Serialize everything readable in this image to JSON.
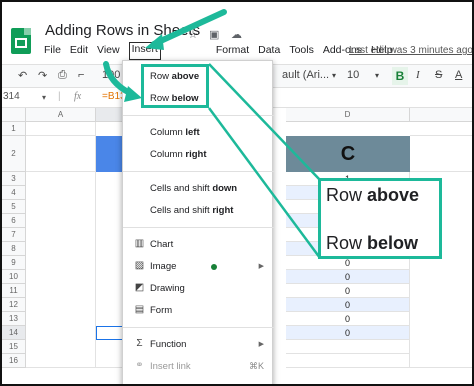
{
  "app": {
    "doc_title": "Adding Rows in Sheets",
    "title_icons": [
      "star-icon",
      "move-to-folder-icon",
      "cloud-saved-icon"
    ],
    "last_edit": "Last edit was 3 minutes ago"
  },
  "menubar": {
    "items": [
      "File",
      "Edit",
      "View",
      "Insert",
      "Format",
      "Data",
      "Tools",
      "Add-ons",
      "Help"
    ],
    "active": "Insert"
  },
  "toolbar": {
    "zoom": "100",
    "font": "ault (Ari...",
    "font_size": "10",
    "bold": "B",
    "italic": "I",
    "strike": "S",
    "text_color": "A"
  },
  "formula_bar": {
    "cell_ref": "314",
    "fx": "fx",
    "formula": "=B13"
  },
  "grid": {
    "col_headers": [
      "A",
      "",
      "D"
    ],
    "row_numbers": [
      "1",
      "2",
      "3",
      "4",
      "5",
      "6",
      "7",
      "8",
      "9",
      "10",
      "11",
      "12",
      "13",
      "14",
      "15",
      "16"
    ],
    "col_d_header": "C",
    "col_d_values": [
      "1",
      "",
      "",
      "",
      "",
      "",
      "0",
      "0",
      "0",
      "0",
      "0",
      "0",
      "0",
      "",
      ""
    ]
  },
  "insert_menu": {
    "items": [
      {
        "pre": "Row ",
        "bold": "above",
        "icon": "",
        "submenu": false
      },
      {
        "pre": "Row ",
        "bold": "below",
        "icon": "",
        "submenu": false
      },
      {
        "pre": "Column ",
        "bold": "left",
        "icon": "",
        "submenu": false
      },
      {
        "pre": "Column ",
        "bold": "right",
        "icon": "",
        "submenu": false
      },
      {
        "pre": "Cells and shift ",
        "bold": "down",
        "icon": "",
        "submenu": false
      },
      {
        "pre": "Cells and shift ",
        "bold": "right",
        "icon": "",
        "submenu": false
      },
      {
        "pre": "Chart",
        "bold": "",
        "icon": "chart-icon",
        "submenu": false
      },
      {
        "pre": "Image",
        "bold": "",
        "icon": "image-icon",
        "submenu": true
      },
      {
        "pre": "Drawing",
        "bold": "",
        "icon": "drawing-icon",
        "submenu": false
      },
      {
        "pre": "Form",
        "bold": "",
        "icon": "form-icon",
        "submenu": false
      },
      {
        "pre": "Function",
        "bold": "",
        "icon": "function-icon",
        "submenu": true
      },
      {
        "pre": "Insert link",
        "bold": "",
        "icon": "link-icon",
        "submenu": false,
        "shortcut": "⌘K",
        "disabled": true
      }
    ]
  },
  "callout": {
    "line1_pre": "Row ",
    "line1_bold": "above",
    "line2_pre": "Row ",
    "line2_bold": "below"
  },
  "colors": {
    "accent": "#1db99a",
    "header_blue": "#4a86e8",
    "header_slate": "#6d8a99",
    "sheets_green": "#0f9d58",
    "stripe": "#e8f0fe"
  }
}
